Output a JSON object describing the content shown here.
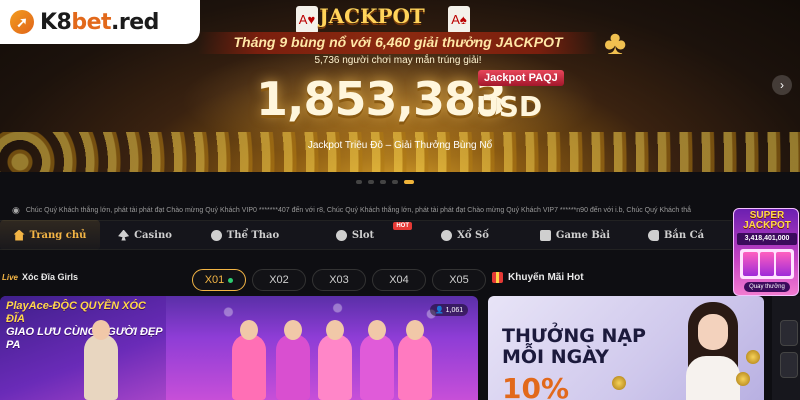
{
  "brand": {
    "logo_text_main": "K8",
    "logo_text_bet": "bet",
    "logo_text_domain": ".red"
  },
  "hero": {
    "badge": "JACKPOT",
    "headline": "Tháng 9 bùng nổ với 6,460 giải thưởng JACKPOT",
    "subline": "5,736 người chơi may mắn trúng giải!",
    "tag": "Jackpot PAQJ",
    "amount": "1,853,383",
    "currency": "USD",
    "tagline": "Jackpot Triệu Đô – Giải Thưởng Bùng Nổ",
    "next_arrow": "›"
  },
  "carousel": {
    "active_index": 4,
    "count": 5
  },
  "marquee": {
    "text": "Chúc Quý Khách thắng lớn, phát tài phát đạt Chào mừng Quý Khách VIP0 *******407 đến với r8, Chúc Quý Khách thắng lớn, phát tài phát đạt Chào mừng Quý Khách VIP7 ******n90 đến với i.b, Chúc Quý Khách thắ"
  },
  "nav": {
    "items": [
      {
        "label": "Trang chủ",
        "icon": "home-icon",
        "active": true
      },
      {
        "label": "Casino",
        "icon": "spade-icon"
      },
      {
        "label": "Thể Thao",
        "icon": "soccer-ball-icon"
      },
      {
        "label": "Slot",
        "icon": "slot-icon",
        "badge": "HOT"
      },
      {
        "label": "Xổ Số",
        "icon": "lottery-icon"
      },
      {
        "label": "Game Bài",
        "icon": "cards-icon"
      },
      {
        "label": "Bắn Cá",
        "icon": "fish-icon"
      }
    ]
  },
  "super_jackpot": {
    "title_line1": "SUPER",
    "title_line2": "JACKPOT",
    "amount": "3,418,401,000",
    "button": "Quay thưởng"
  },
  "live_section": {
    "title": "Xóc Đĩa Girls",
    "tabs": [
      "X01",
      "X02",
      "X03",
      "X04",
      "X05"
    ],
    "active_tab": 0,
    "promo_line1": "PlayAce-ĐỘC QUYỀN XÓC ĐĨA",
    "promo_line2": "GIAO LƯU CÙNG NGƯỜI ĐẸP PA",
    "viewers": "1,061"
  },
  "promo_section": {
    "title": "Khuyến Mãi Hot",
    "banner_line1": "THƯỞNG NẠP",
    "banner_line2": "MỖI NGÀY",
    "banner_pct": "10%"
  },
  "colors": {
    "accent": "#f3b545",
    "live": "#2ecc71",
    "hot": "#e53935"
  }
}
